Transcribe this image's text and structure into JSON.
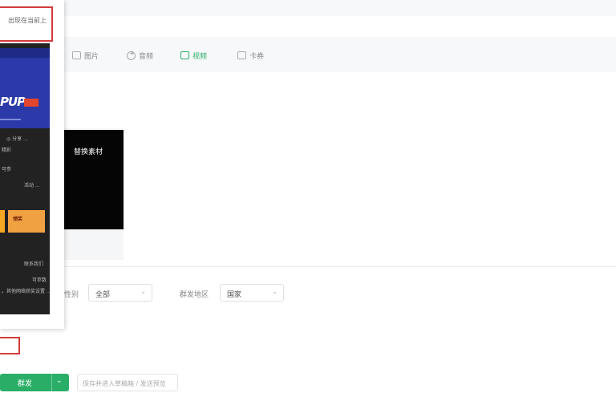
{
  "tip": {
    "text": "出现在当前上"
  },
  "toolbar": {
    "items": [
      {
        "label": "图片",
        "icon": "image-icon"
      },
      {
        "label": "音频",
        "icon": "audio-icon"
      },
      {
        "label": "视频",
        "icon": "video-icon",
        "active": true
      },
      {
        "label": "卡券",
        "icon": "coupon-icon"
      }
    ]
  },
  "media": {
    "replace_label": "替换素材"
  },
  "phone": {
    "banner_small": "",
    "banner_big": "PUP",
    "row1": "◎ 分享 ...",
    "row2": "精彩",
    "row3": "可参",
    "row4": "活动 ...",
    "tile_text": "领奖",
    "row5": "联系我们",
    "row6": "可参数",
    "row7": "。其他网络获奖设置 ..."
  },
  "filters": {
    "gender_label": "性别",
    "gender_value": "全部",
    "region_label": "群发地区",
    "region_value": "国家"
  },
  "actions": {
    "primary_label": "群发",
    "secondary_label": "保存并进入草稿箱 / 发送预览"
  },
  "colors": {
    "accent": "#2aae67",
    "warning": "#d43b3b"
  }
}
